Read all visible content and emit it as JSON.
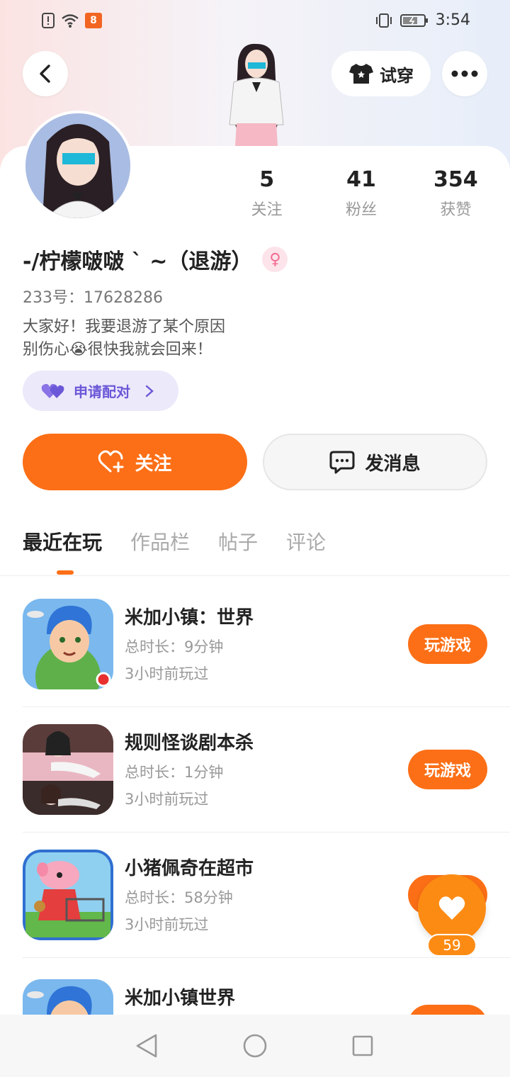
{
  "status_bar": {
    "time": "3:54"
  },
  "header": {
    "tryon_label": "试穿"
  },
  "profile": {
    "name": "-/柠檬啵啵 ` ~（退游）",
    "gender_symbol": "♀",
    "uid_label": "233号：",
    "uid": "17628286",
    "bio_line1": "大家好！我要退游了某个原因",
    "bio_line2": "别伤心😭很快我就会回来！",
    "pair_label": "申请配对"
  },
  "stats": [
    {
      "num": "5",
      "label": "关注"
    },
    {
      "num": "41",
      "label": "粉丝"
    },
    {
      "num": "354",
      "label": "获赞"
    }
  ],
  "actions": {
    "follow_label": "关注",
    "message_label": "发消息"
  },
  "tabs": [
    "最近在玩",
    "作品栏",
    "帖子",
    "评论"
  ],
  "games": [
    {
      "title": "米加小镇：世界",
      "duration": "总时长：9分钟",
      "ago": "3小时前玩过",
      "button": "玩游戏"
    },
    {
      "title": "规则怪谈剧本杀",
      "duration": "总时长：1分钟",
      "ago": "3小时前玩过",
      "button": "玩游戏"
    },
    {
      "title": "小猪佩奇在超市",
      "duration": "总时长：58分钟",
      "ago": "3小时前玩过",
      "button": "玩游戏"
    },
    {
      "title": "米加小镇世界",
      "duration": "",
      "ago": "",
      "button": "玩游戏"
    }
  ],
  "like_fab": {
    "count": "59"
  },
  "colors": {
    "accent": "#fc6f16",
    "pair_purple": "#6a58d8"
  }
}
